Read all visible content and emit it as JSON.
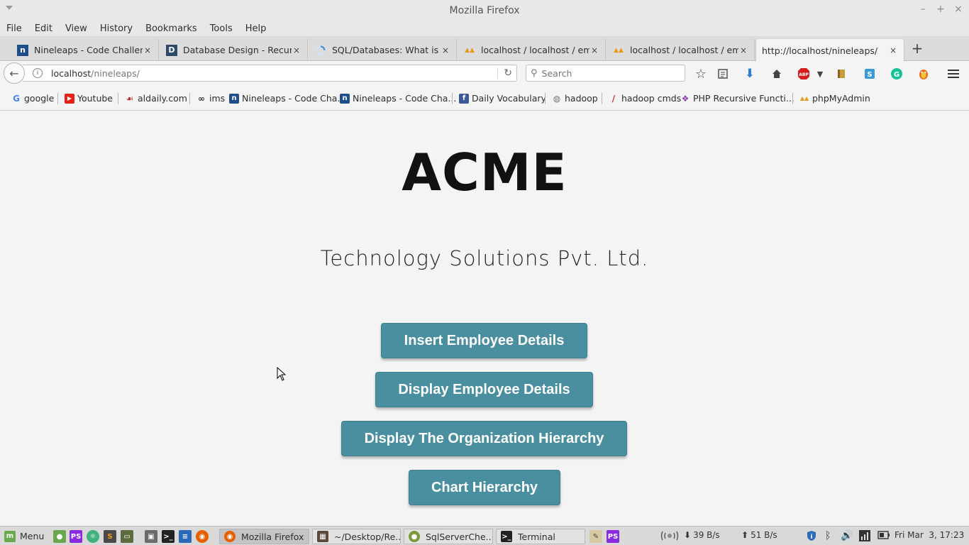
{
  "window": {
    "title": "Mozilla Firefox",
    "controls": [
      "–",
      "+",
      "×"
    ]
  },
  "menubar": [
    "File",
    "Edit",
    "View",
    "History",
    "Bookmarks",
    "Tools",
    "Help"
  ],
  "tabs": [
    {
      "label": "Nineleaps - Code Challen...",
      "icon": "nineleaps-icon",
      "icon_color": "#1f4e8c",
      "active": false
    },
    {
      "label": "Database Design - Recur...",
      "icon": "d-icon",
      "icon_color": "#2d4a66",
      "active": false
    },
    {
      "label": "SQL/Databases: What is ...",
      "icon": "loading-icon",
      "icon_color": "#3b8fd8",
      "active": false
    },
    {
      "label": "localhost / localhost / em...",
      "icon": "phpmyadmin-icon",
      "icon_color": "#e59c1b",
      "active": false
    },
    {
      "label": "localhost / localhost / em...",
      "icon": "phpmyadmin-icon",
      "icon_color": "#e59c1b",
      "active": false
    },
    {
      "label": "http://localhost/nineleaps/",
      "icon": "",
      "icon_color": "",
      "active": true
    }
  ],
  "tab_close": "×",
  "new_tab": "+",
  "nav": {
    "back": "←",
    "url_host": "localhost",
    "url_path": "/nineleaps/",
    "info": "i",
    "reload": "↻",
    "search_placeholder": "Search",
    "search_icon": "⚲"
  },
  "toolbar_icons": [
    {
      "name": "bookmark-star-icon",
      "glyph": "☆",
      "color": "#444"
    },
    {
      "name": "reading-list-icon",
      "glyph": "▤",
      "color": "#444"
    },
    {
      "name": "download-icon",
      "glyph": "⬇",
      "color": "#2a7bd8"
    },
    {
      "name": "home-icon",
      "glyph": "⌂",
      "color": "#444"
    },
    {
      "name": "adblock-icon",
      "glyph": "ABP",
      "color": "#d41e1e"
    },
    {
      "name": "dropdown-icon",
      "glyph": "▾",
      "color": "#444"
    },
    {
      "name": "wallet-icon",
      "glyph": "▮",
      "color": "#c79a3a"
    },
    {
      "name": "s-extension-icon",
      "glyph": "S",
      "color": "#3a9ad9"
    },
    {
      "name": "grammarly-icon",
      "glyph": "G",
      "color": "#15c39a"
    },
    {
      "name": "firebug-icon",
      "glyph": "✹",
      "color": "#e8701a"
    },
    {
      "name": "hamburger-menu-icon",
      "glyph": "≡",
      "color": "#333"
    }
  ],
  "bookmarks": [
    {
      "label": "google",
      "icon": "google-icon",
      "glyph": "G",
      "color": "#4285f4"
    },
    {
      "label": "Youtube",
      "icon": "youtube-icon",
      "glyph": "▶",
      "color": "#e62117"
    },
    {
      "label": "aldaily.com",
      "icon": "aldaily-icon",
      "glyph": "A",
      "color": "#b03030"
    },
    {
      "label": "ims",
      "icon": "ims-icon",
      "glyph": "∞",
      "color": "#333"
    },
    {
      "label": "Nineleaps - Code Cha...",
      "icon": "nineleaps-icon",
      "glyph": "n",
      "color": "#1f4e8c"
    },
    {
      "label": "Nineleaps - Code Cha...",
      "icon": "nineleaps-icon",
      "glyph": "n",
      "color": "#1f4e8c"
    },
    {
      "label": "Daily Vocabulary",
      "icon": "facebook-icon",
      "glyph": "f",
      "color": "#3b5998"
    },
    {
      "label": "hadoop",
      "icon": "globe-icon",
      "glyph": "◍",
      "color": "#777"
    },
    {
      "label": "hadoop cmds",
      "icon": "pen-icon",
      "glyph": "/",
      "color": "#c0392b"
    },
    {
      "label": "PHP Recursive Functi...",
      "icon": "puzzle-icon",
      "glyph": "❖",
      "color": "#8e44ad"
    },
    {
      "label": "phpMyAdmin",
      "icon": "phpmyadmin-icon",
      "glyph": "P",
      "color": "#e59c1b"
    }
  ],
  "page": {
    "brand": "ACME",
    "tagline": "Technology Solutions Pvt. Ltd.",
    "buttons": [
      {
        "label": "Insert Employee Details"
      },
      {
        "label": "Display Employee Details"
      },
      {
        "label": "Display The Organization Hierarchy"
      },
      {
        "label": "Chart Hierarchy"
      }
    ],
    "button_color": "#4a8fa0"
  },
  "taskbar": {
    "menu_label": "Menu",
    "windows": [
      {
        "label": "Mozilla Firefox",
        "icon": "firefox-icon",
        "color": "#e66000",
        "active": true
      },
      {
        "label": "~/Desktop/Re...",
        "icon": "text-editor-icon",
        "color": "#5a4a3a",
        "active": false
      },
      {
        "label": "SqlServerChe...",
        "icon": "sql-icon",
        "color": "#7a9a3a",
        "active": false
      },
      {
        "label": "Terminal",
        "icon": "terminal-icon",
        "color": "#222",
        "active": false
      }
    ],
    "net_down": "39 B/s",
    "net_up": "51 B/s",
    "clock": "Fri Mar  3, 17:23"
  }
}
